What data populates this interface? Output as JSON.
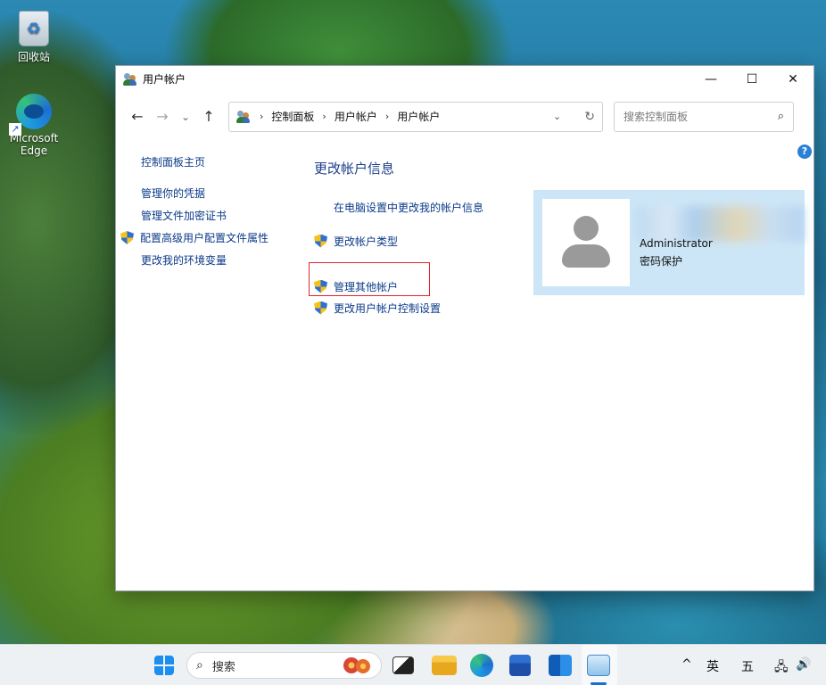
{
  "desktop": {
    "recycle_bin_label": "回收站",
    "edge_label": "Microsoft Edge"
  },
  "window": {
    "title": "用户帐户",
    "controls": {
      "minimize": "—",
      "maximize": "☐",
      "close": "✕"
    }
  },
  "nav": {
    "back": "←",
    "forward": "→",
    "recent": "⌄",
    "up": "↑",
    "breadcrumbs": [
      "控制面板",
      "用户帐户",
      "用户帐户"
    ],
    "separator": "›",
    "dropdown": "⌄",
    "refresh": "↻",
    "search_placeholder": "搜索控制面板",
    "search_icon": "⌕"
  },
  "help_label": "?",
  "left_pane": {
    "home": "控制面板主页",
    "links": [
      "管理你的凭据",
      "管理文件加密证书",
      "配置高级用户配置文件属性",
      "更改我的环境变量"
    ]
  },
  "main": {
    "heading": "更改帐户信息",
    "link_pc_settings": "在电脑设置中更改我的帐户信息",
    "link_change_type": "更改帐户类型",
    "link_manage_other": "管理其他帐户",
    "link_uac": "更改用户帐户控制设置"
  },
  "account": {
    "name": "Administrator",
    "type": "密码保护"
  },
  "taskbar": {
    "search_label": "搜索",
    "search_icon": "⌕",
    "tray_chevron": "^",
    "ime_lang": "英",
    "ime_mode": "五",
    "network_icon": "🖧",
    "volume_icon": "🔊"
  },
  "colors": {
    "link": "#0b3a8a",
    "heading": "#1e3f8a",
    "highlight_box": "#e0242a",
    "account_card": "#cde6f7"
  },
  "icons": [
    "recycle-bin-icon",
    "edge-icon",
    "user-accounts-icon",
    "shield-icon",
    "user-avatar-icon",
    "start-icon",
    "taskview-icon",
    "file-explorer-icon",
    "store-icon",
    "outlook-icon",
    "control-panel-icon"
  ]
}
